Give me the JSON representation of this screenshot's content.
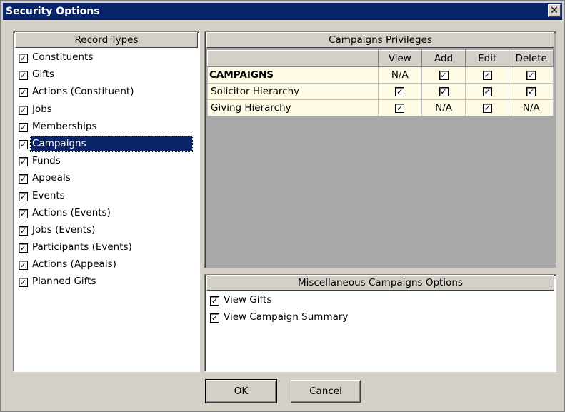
{
  "window": {
    "title": "Security Options",
    "close_glyph": "✕"
  },
  "record_types": {
    "header": "Record Types",
    "items": [
      {
        "label": "Constituents",
        "checked": true
      },
      {
        "label": "Gifts",
        "checked": true
      },
      {
        "label": "Actions (Constituent)",
        "checked": true
      },
      {
        "label": "Jobs",
        "checked": true
      },
      {
        "label": "Memberships",
        "checked": true
      },
      {
        "label": "Campaigns",
        "checked": true,
        "selected": true
      },
      {
        "label": "Funds",
        "checked": true
      },
      {
        "label": "Appeals",
        "checked": true
      },
      {
        "label": "Events",
        "checked": true
      },
      {
        "label": "Actions (Events)",
        "checked": true
      },
      {
        "label": "Jobs (Events)",
        "checked": true
      },
      {
        "label": "Participants (Events)",
        "checked": true
      },
      {
        "label": "Actions (Appeals)",
        "checked": true
      },
      {
        "label": "Planned Gifts",
        "checked": true
      }
    ]
  },
  "privileges": {
    "header": "Campaigns Privileges",
    "columns": [
      "View",
      "Add",
      "Edit",
      "Delete"
    ],
    "rows": [
      {
        "name": "CAMPAIGNS",
        "values": [
          "N/A",
          true,
          true,
          true
        ]
      },
      {
        "name": "Solicitor Hierarchy",
        "values": [
          true,
          true,
          true,
          true
        ]
      },
      {
        "name": "Giving Hierarchy",
        "values": [
          true,
          "N/A",
          true,
          "N/A"
        ]
      }
    ]
  },
  "misc": {
    "header": "Miscellaneous Campaigns Options",
    "items": [
      {
        "label": "View Gifts",
        "checked": true
      },
      {
        "label": "View Campaign Summary",
        "checked": true
      }
    ]
  },
  "buttons": {
    "ok": "OK",
    "cancel": "Cancel"
  },
  "check_glyph": "✓"
}
